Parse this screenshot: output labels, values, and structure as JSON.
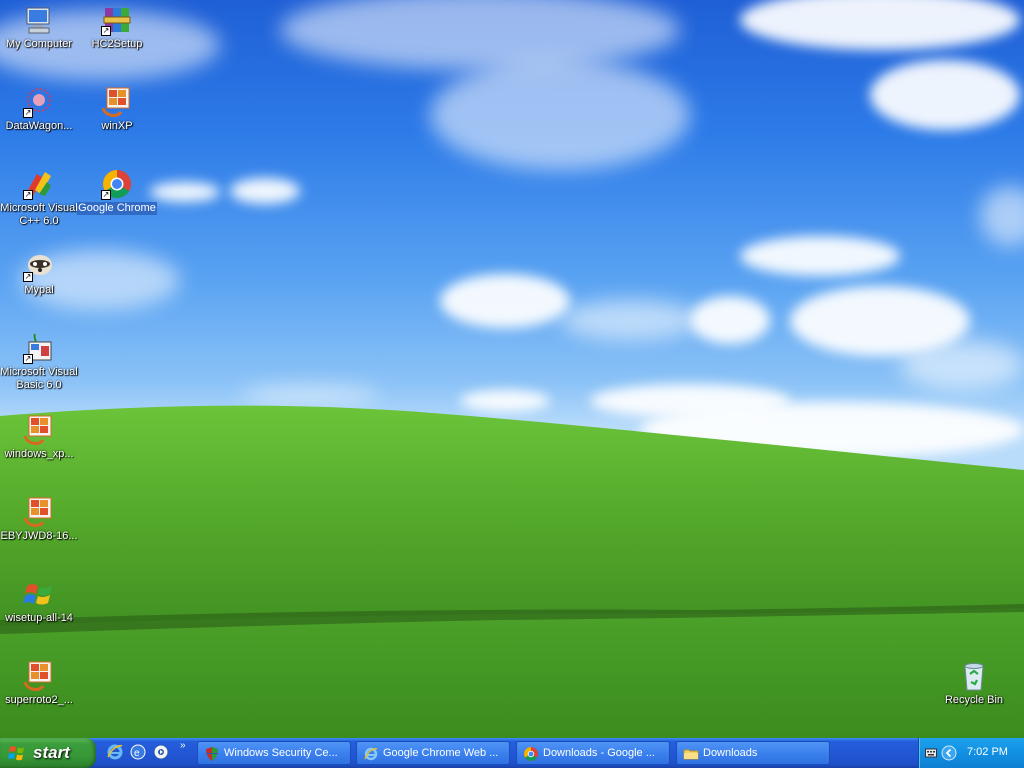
{
  "desktop": {
    "icons": [
      {
        "label": "My Computer"
      },
      {
        "label": "HC2Setup"
      },
      {
        "label": "DataWagon..."
      },
      {
        "label": "winXP"
      },
      {
        "label": "Microsoft Visual C++ 6.0"
      },
      {
        "label": "Google Chrome"
      },
      {
        "label": "Mypal"
      },
      {
        "label": "Microsoft Visual Basic 6.0"
      },
      {
        "label": "windows_xp..."
      },
      {
        "label": "EBYJWD8-16..."
      },
      {
        "label": "wisetup-all-14"
      },
      {
        "label": "superroto2_..."
      },
      {
        "label": "Recycle Bin"
      }
    ]
  },
  "taskbar": {
    "start_label": "start",
    "quick_launch_more": "»",
    "tasks": [
      {
        "label": "Windows Security Ce...",
        "icon": "shield-icon"
      },
      {
        "label": "Google Chrome Web ...",
        "icon": "ie-icon"
      },
      {
        "label": "Downloads - Google ...",
        "icon": "chrome-icon"
      },
      {
        "label": "Downloads",
        "icon": "folder-icon"
      }
    ],
    "clock": "7:02 PM"
  },
  "colors": {
    "taskbar": "#245edb",
    "start_button": "#3c9d3c",
    "tray": "#1290e3",
    "selection": "#316ac5"
  }
}
